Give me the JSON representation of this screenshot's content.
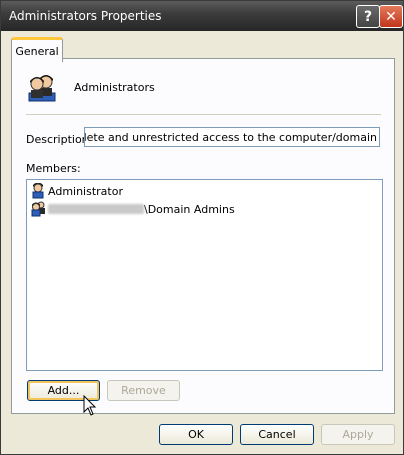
{
  "window": {
    "title": "Administrators Properties"
  },
  "titlebar_buttons": {
    "help": "?",
    "close": "✕"
  },
  "tabs": [
    {
      "label": "General"
    }
  ],
  "group": {
    "name": "Administrators",
    "icon": "user-group-icon"
  },
  "description": {
    "label": "Description:",
    "value": "mplete and unrestricted access to the computer/domain"
  },
  "members": {
    "label": "Members:",
    "items": [
      {
        "name": "Administrator",
        "icon": "user-icon"
      },
      {
        "name": "\\Domain Admins",
        "icon": "user-group-icon",
        "prefix_redacted": true
      }
    ]
  },
  "actions": {
    "add": "Add...",
    "remove": "Remove"
  },
  "footer": {
    "ok": "OK",
    "cancel": "Cancel",
    "apply": "Apply"
  },
  "colors": {
    "accent": "#ffc83c",
    "titlebar": "#3d3d3d",
    "close": "#c0351b"
  }
}
